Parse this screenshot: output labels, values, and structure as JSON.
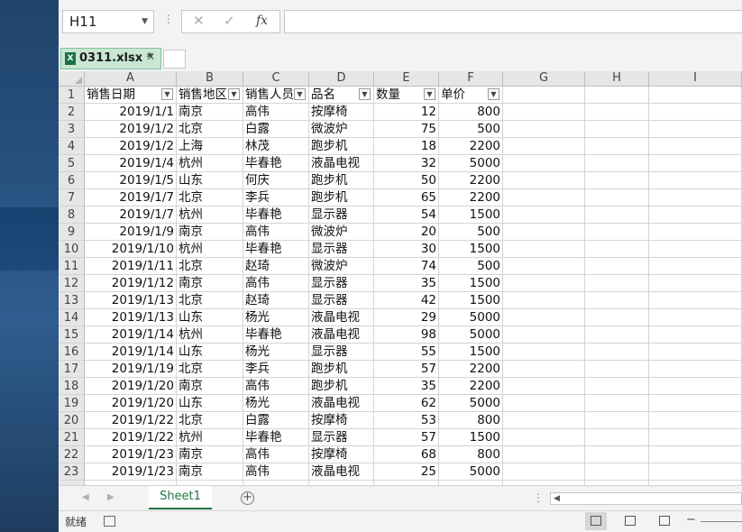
{
  "formula_bar": {
    "name_box": "H11",
    "cancel_icon": "✕",
    "enter_icon": "✓",
    "fx_label": "fx",
    "formula": ""
  },
  "workbook_tab": {
    "name": "0311.xlsx *",
    "close": "✕"
  },
  "columns": [
    "A",
    "B",
    "C",
    "D",
    "E",
    "F",
    "G",
    "H",
    "I"
  ],
  "headers": [
    "销售日期",
    "销售地区",
    "销售人员",
    "品名",
    "数量",
    "单价"
  ],
  "rows": [
    [
      "2019/1/1",
      "南京",
      "高伟",
      "按摩椅",
      "12",
      "800"
    ],
    [
      "2019/1/2",
      "北京",
      "白露",
      "微波炉",
      "75",
      "500"
    ],
    [
      "2019/1/2",
      "上海",
      "林茂",
      "跑步机",
      "18",
      "2200"
    ],
    [
      "2019/1/4",
      "杭州",
      "毕春艳",
      "液晶电视",
      "32",
      "5000"
    ],
    [
      "2019/1/5",
      "山东",
      "何庆",
      "跑步机",
      "50",
      "2200"
    ],
    [
      "2019/1/7",
      "北京",
      "李兵",
      "跑步机",
      "65",
      "2200"
    ],
    [
      "2019/1/7",
      "杭州",
      "毕春艳",
      "显示器",
      "54",
      "1500"
    ],
    [
      "2019/1/9",
      "南京",
      "高伟",
      "微波炉",
      "20",
      "500"
    ],
    [
      "2019/1/10",
      "杭州",
      "毕春艳",
      "显示器",
      "30",
      "1500"
    ],
    [
      "2019/1/11",
      "北京",
      "赵琦",
      "微波炉",
      "74",
      "500"
    ],
    [
      "2019/1/12",
      "南京",
      "高伟",
      "显示器",
      "35",
      "1500"
    ],
    [
      "2019/1/13",
      "北京",
      "赵琦",
      "显示器",
      "42",
      "1500"
    ],
    [
      "2019/1/13",
      "山东",
      "杨光",
      "液晶电视",
      "29",
      "5000"
    ],
    [
      "2019/1/14",
      "杭州",
      "毕春艳",
      "液晶电视",
      "98",
      "5000"
    ],
    [
      "2019/1/14",
      "山东",
      "杨光",
      "显示器",
      "55",
      "1500"
    ],
    [
      "2019/1/19",
      "北京",
      "李兵",
      "跑步机",
      "57",
      "2200"
    ],
    [
      "2019/1/20",
      "南京",
      "高伟",
      "跑步机",
      "35",
      "2200"
    ],
    [
      "2019/1/20",
      "山东",
      "杨光",
      "液晶电视",
      "62",
      "5000"
    ],
    [
      "2019/1/22",
      "北京",
      "白露",
      "按摩椅",
      "53",
      "800"
    ],
    [
      "2019/1/22",
      "杭州",
      "毕春艳",
      "显示器",
      "57",
      "1500"
    ],
    [
      "2019/1/23",
      "南京",
      "高伟",
      "按摩椅",
      "68",
      "800"
    ],
    [
      "2019/1/23",
      "南京",
      "高伟",
      "液晶电视",
      "25",
      "5000"
    ]
  ],
  "sheet_tab": "Sheet1",
  "add_sheet": "+",
  "status": {
    "ready": "就绪"
  },
  "icons": [
    "dropdown-arrow-icon",
    "filter-dropdown-icon",
    "excel-file-icon",
    "close-icon",
    "add-sheet-icon",
    "scroll-left-icon",
    "scroll-right-icon",
    "macro-record-icon",
    "normal-view-icon",
    "page-layout-view-icon",
    "page-break-view-icon",
    "zoom-out-icon"
  ],
  "colors": {
    "accent": "#217346",
    "tab_bg": "#c9e7d2"
  }
}
